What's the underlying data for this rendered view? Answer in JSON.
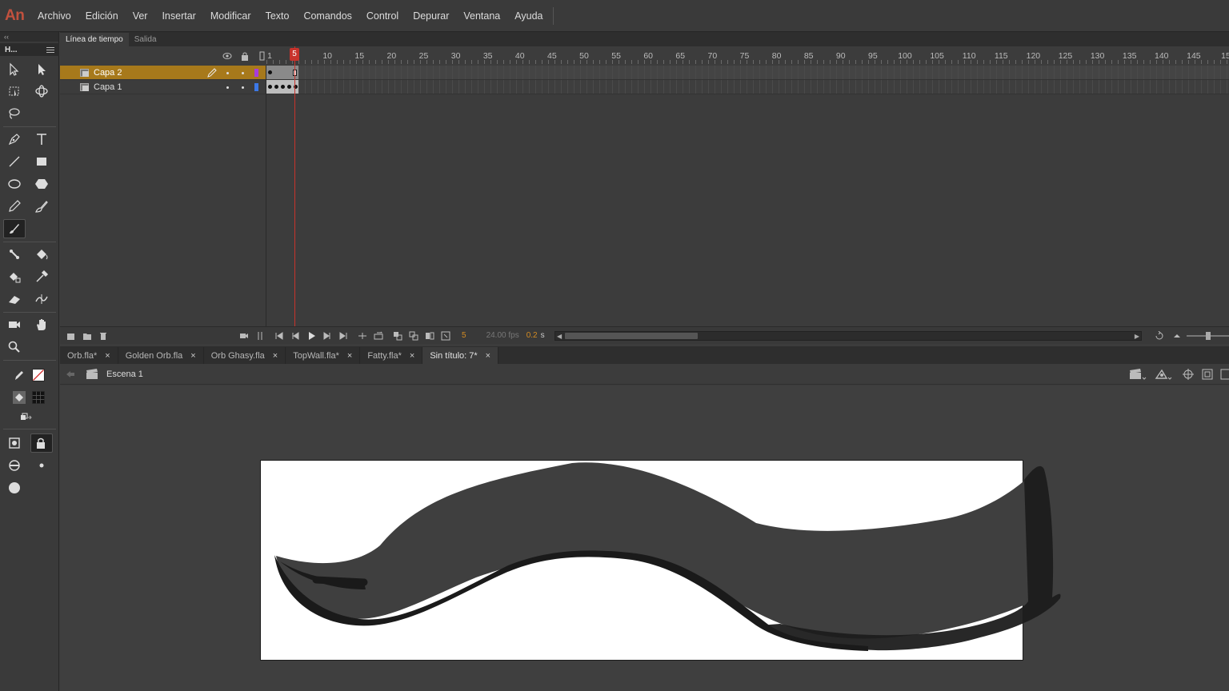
{
  "app": {
    "logo": "An"
  },
  "menu": [
    "Archivo",
    "Edición",
    "Ver",
    "Insertar",
    "Modificar",
    "Texto",
    "Comandos",
    "Control",
    "Depurar",
    "Ventana",
    "Ayuda"
  ],
  "tools_panel": {
    "collapse": "‹‹",
    "title": "H..."
  },
  "timeline": {
    "tabs": [
      "Línea de tiempo",
      "Salida"
    ],
    "ruler": [
      "1",
      "5",
      "10",
      "15",
      "20",
      "25",
      "30",
      "35",
      "40",
      "45",
      "50",
      "55",
      "60",
      "65",
      "70",
      "75",
      "80",
      "85",
      "90",
      "95",
      "100",
      "105",
      "110",
      "115",
      "120",
      "125",
      "130",
      "135",
      "140",
      "145",
      "15"
    ],
    "current_frame": "5",
    "layers": [
      {
        "name": "Capa 2",
        "selected": true,
        "color": "#a83cdc"
      },
      {
        "name": "Capa 1",
        "selected": false,
        "color": "#3c78e6"
      }
    ],
    "status": {
      "frame": "5",
      "fps": "24.00 fps",
      "time": "0.2",
      "time_unit": "s"
    }
  },
  "doc_tabs": [
    {
      "label": "Orb.fla*",
      "active": false
    },
    {
      "label": "Golden Orb.fla",
      "active": false
    },
    {
      "label": "Orb Ghasy.fla",
      "active": false
    },
    {
      "label": "TopWall.fla*",
      "active": false
    },
    {
      "label": "Fatty.fla*",
      "active": false
    },
    {
      "label": "Sin título: 7*",
      "active": true
    }
  ],
  "editbar": {
    "scene": "Escena 1"
  },
  "colors": {
    "accent": "#a7791b",
    "playhead": "#c8332c",
    "stage": "#ffffff"
  }
}
